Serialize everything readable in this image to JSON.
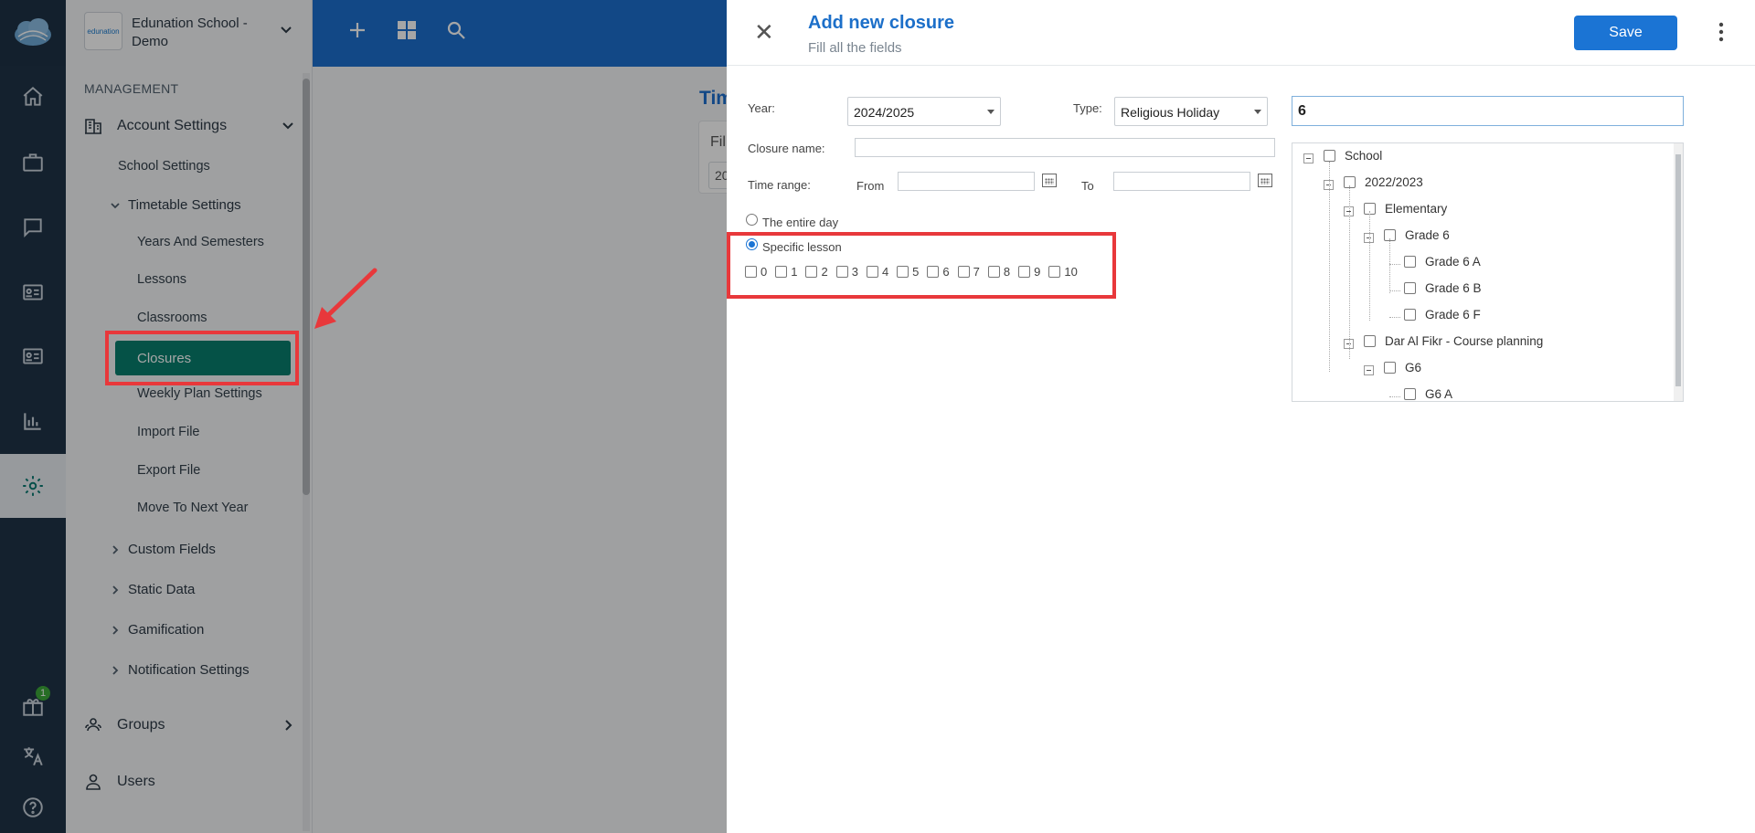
{
  "sidemenu": {
    "school_logo_text": "edunation",
    "school_name": "Edunation School - Demo",
    "section": "MANAGEMENT",
    "account_settings": "Account Settings",
    "school_settings": "School Settings",
    "timetable_settings": "Timetable Settings",
    "timetable_items": [
      "Years And Semesters",
      "Lessons",
      "Classrooms",
      "Closures",
      "Weekly Plan Settings",
      "Import File",
      "Export File",
      "Move To Next Year"
    ],
    "collapsed": [
      "Custom Fields",
      "Static Data",
      "Gamification",
      "Notification Settings"
    ],
    "groups": "Groups",
    "users": "Users"
  },
  "rail": {
    "gift_badge": "1",
    "icons": [
      "cloud-logo-icon",
      "home-icon",
      "briefcase-icon",
      "chat-icon",
      "id-card-icon",
      "id-card-icon",
      "bar-chart-icon",
      "gear-icon",
      "gift-icon",
      "translate-icon",
      "help-icon"
    ]
  },
  "background": {
    "title_peek": "Tim",
    "card_label_peek": "Fil",
    "card_value_peek": "20"
  },
  "drawer": {
    "title": "Add new closure",
    "subtitle": "Fill all the fields",
    "save_label": "Save",
    "year_label": "Year:",
    "year_value": "2024/2025",
    "type_label": "Type:",
    "type_value": "Religious Holiday",
    "search_value": "6",
    "closure_name_label": "Closure name:",
    "time_range_label": "Time range:",
    "from_label": "From",
    "to_label": "To",
    "entire_day_label": "The entire day",
    "specific_lesson_label": "Specific lesson",
    "selected_mode": "Specific lesson",
    "lessons": [
      "0",
      "1",
      "2",
      "3",
      "4",
      "5",
      "6",
      "7",
      "8",
      "9",
      "10"
    ]
  },
  "tree": {
    "nodes": [
      "School",
      "2022/2023",
      "Elementary",
      "Grade 6",
      "Grade 6 A",
      "Grade 6 B",
      "Grade 6 F",
      "Dar Al Fikr - Course planning",
      "G6",
      "G6 A"
    ]
  },
  "colors": {
    "accent": "#1b74d4",
    "active_menu": "#087f6e",
    "highlight": "#e8383b",
    "rail": "#1f3347"
  }
}
